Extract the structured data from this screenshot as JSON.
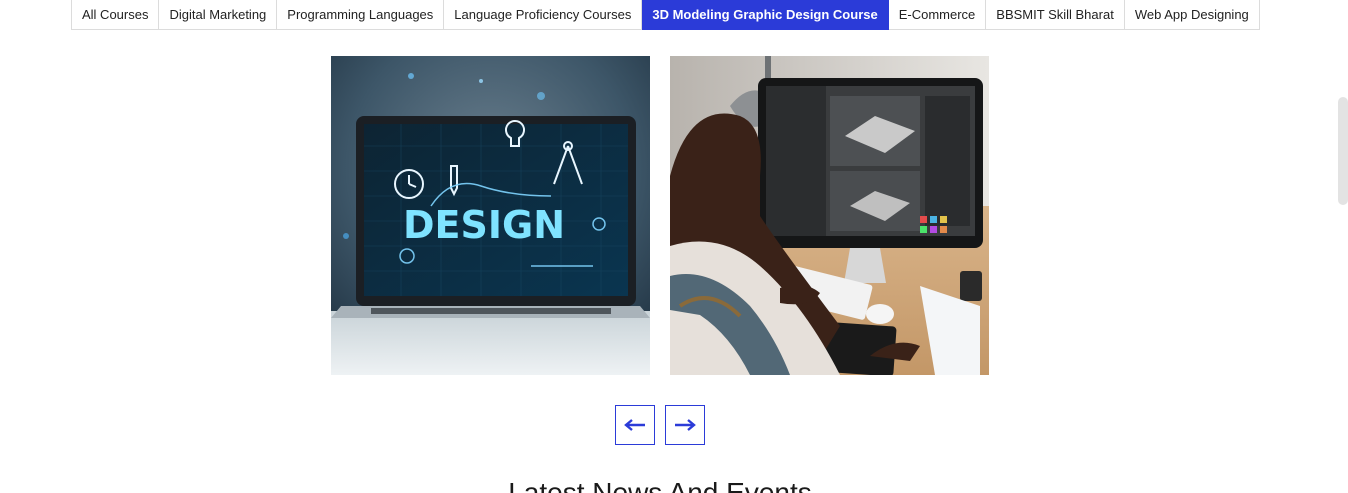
{
  "tabs": [
    {
      "label": "All Courses",
      "active": false
    },
    {
      "label": "Digital Marketing",
      "active": false
    },
    {
      "label": "Programming Languages",
      "active": false
    },
    {
      "label": "Language Proficiency Courses",
      "active": false
    },
    {
      "label": "3D Modeling Graphic Design Course",
      "active": true
    },
    {
      "label": "E-Commerce",
      "active": false
    },
    {
      "label": "BBSMIT Skill Bharat",
      "active": false
    },
    {
      "label": "Web App Designing",
      "active": false
    }
  ],
  "gallery": {
    "image1_word": "DESIGN",
    "prev_icon": "arrow-left-icon",
    "next_icon": "arrow-right-icon"
  },
  "section": {
    "title": "Latest News And Events"
  },
  "colors": {
    "accent": "#2b3bd8"
  }
}
